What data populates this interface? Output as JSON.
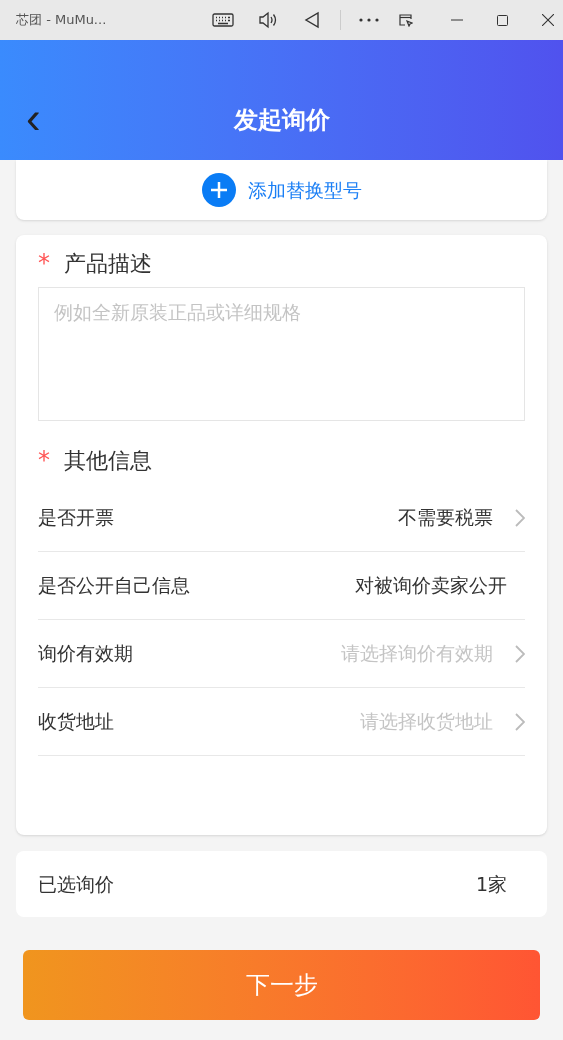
{
  "window": {
    "title": "芯团 - MuMu..."
  },
  "header": {
    "back": "‹",
    "title": "发起询价"
  },
  "add_button": {
    "label": "添加替换型号"
  },
  "description": {
    "label": "产品描述",
    "required_mark": "*",
    "placeholder": "例如全新原装正品或详细规格"
  },
  "other_info": {
    "label": "其他信息",
    "required_mark": "*",
    "rows": [
      {
        "label": "是否开票",
        "kind": "select",
        "value": "不需要税票"
      },
      {
        "label": "是否公开自己信息",
        "kind": "static",
        "value": "对被询价卖家公开"
      },
      {
        "label": "询价有效期",
        "kind": "select",
        "placeholder": "请选择询价有效期"
      },
      {
        "label": "收货地址",
        "kind": "select",
        "placeholder": "请选择收货地址"
      }
    ]
  },
  "selected": {
    "label": "已选询价",
    "value": "1家"
  },
  "next_button": {
    "label": "下一步"
  }
}
